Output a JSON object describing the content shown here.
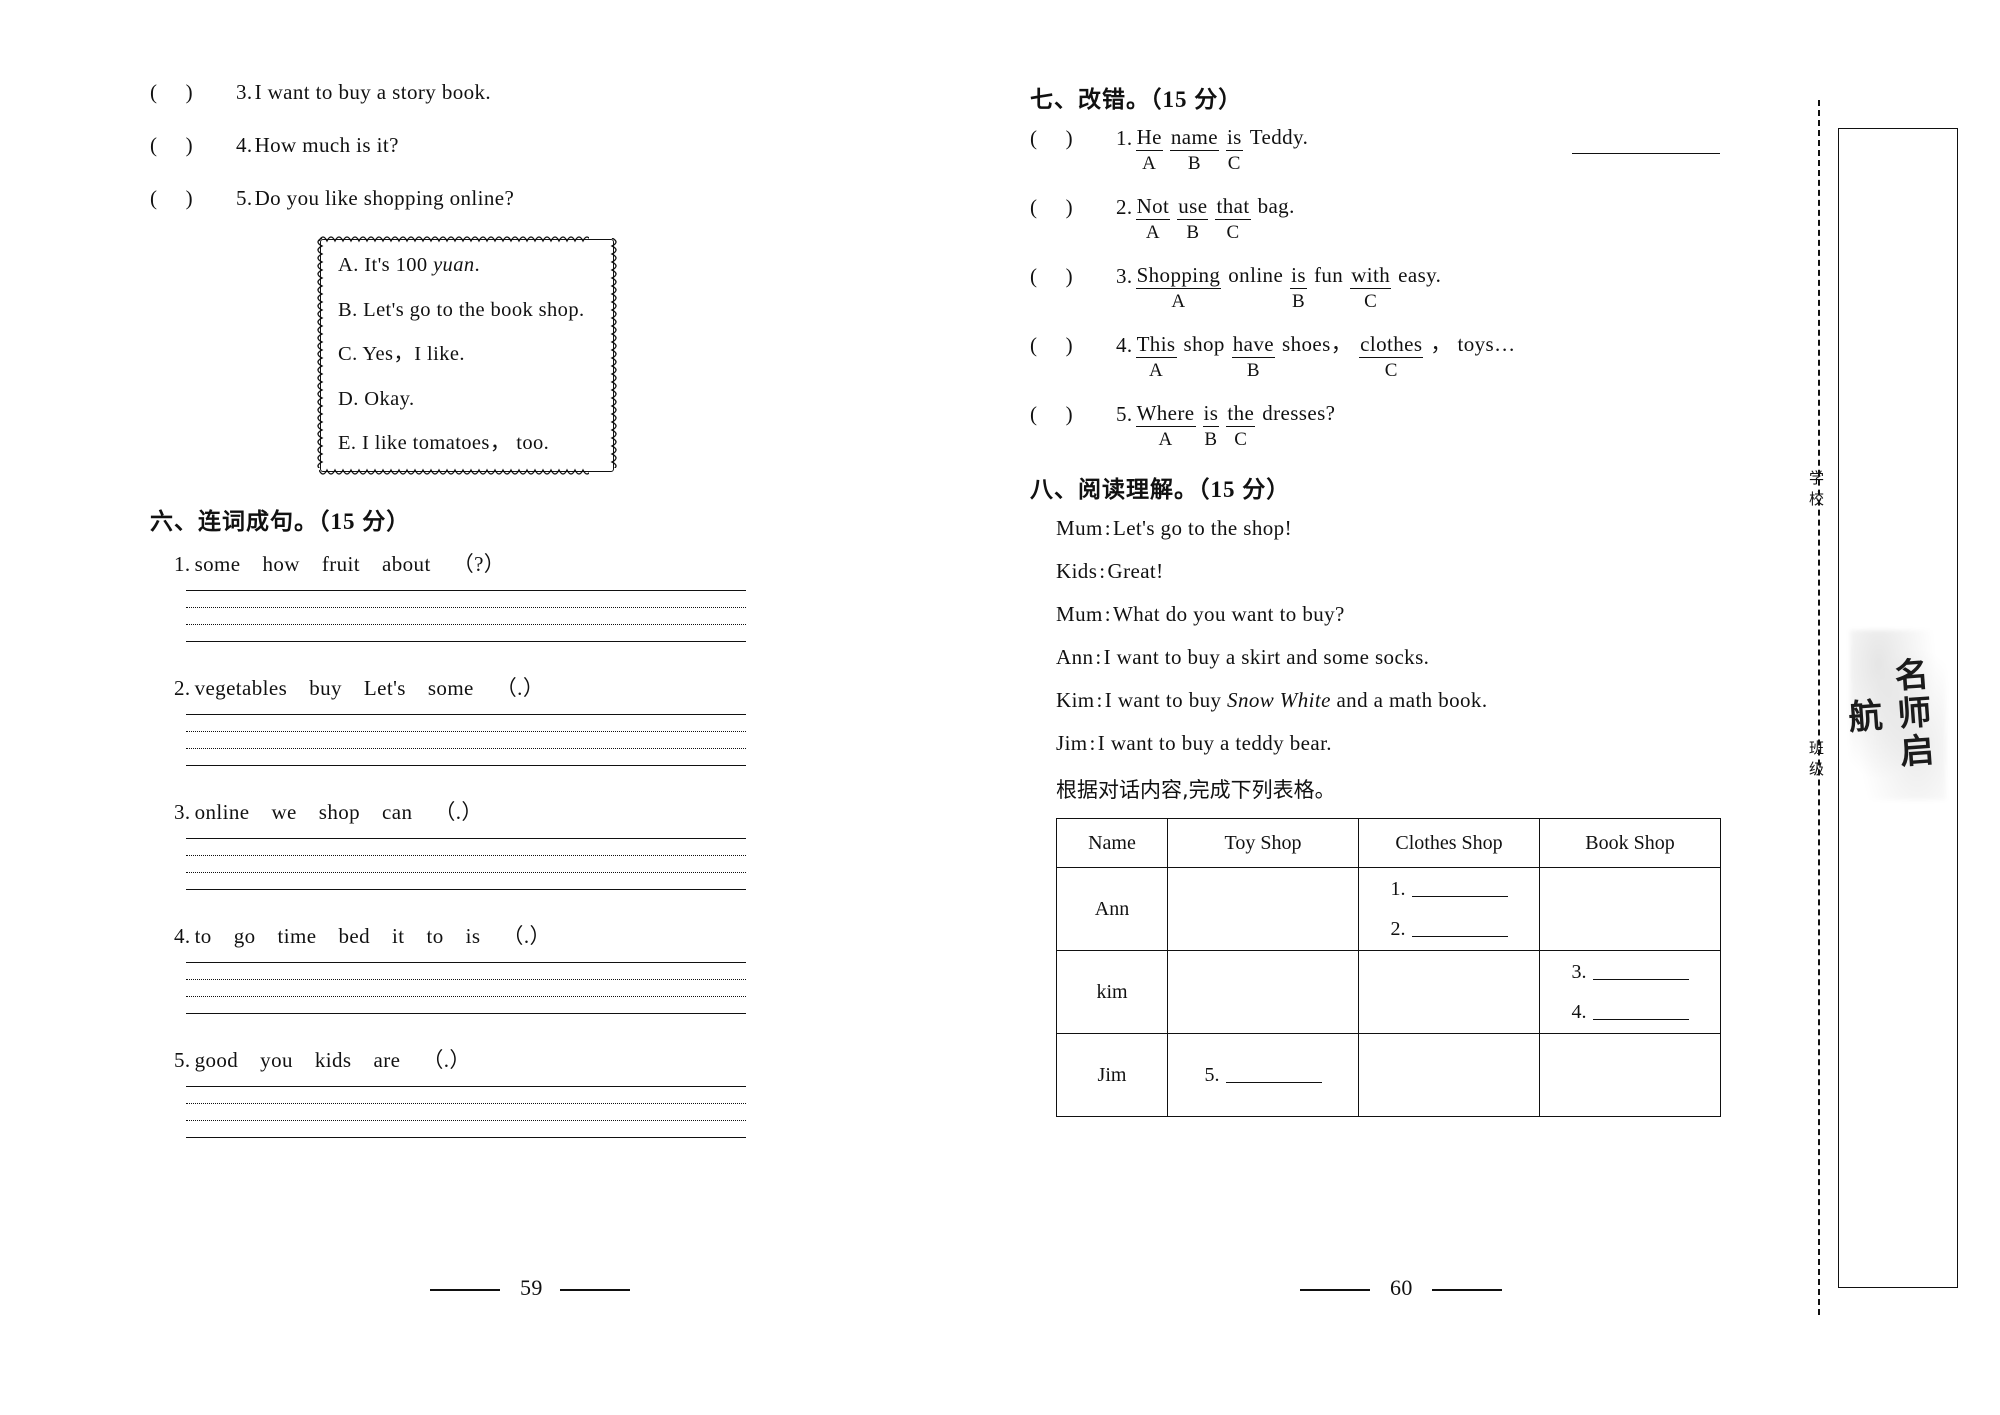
{
  "left_page": {
    "matching_items": [
      {
        "num": "3.",
        "text": "I want to buy a story book."
      },
      {
        "num": "4.",
        "text": "How much is it?"
      },
      {
        "num": "5.",
        "text": "Do you like shopping online?"
      }
    ],
    "options_box": {
      "options": [
        {
          "letter": "A.",
          "pre": "It's 100 ",
          "italic": "yuan",
          "post": "."
        },
        {
          "letter": "B.",
          "pre": "Let's go to the book shop.",
          "italic": "",
          "post": ""
        },
        {
          "letter": "C.",
          "pre": "Yes，I like.",
          "italic": "",
          "post": ""
        },
        {
          "letter": "D.",
          "pre": "Okay.",
          "italic": "",
          "post": ""
        },
        {
          "letter": "E.",
          "pre": "I like tomatoes， too.",
          "italic": "",
          "post": ""
        }
      ]
    },
    "section_six": {
      "heading": "六、连词成句。",
      "points": "（15 分）",
      "items": [
        {
          "num": "1.",
          "words": [
            "some",
            "how",
            "fruit",
            "about"
          ],
          "punct": "（?）"
        },
        {
          "num": "2.",
          "words": [
            "vegetables",
            "buy",
            "Let's",
            "some"
          ],
          "punct": "（.）"
        },
        {
          "num": "3.",
          "words": [
            "online",
            "we",
            "shop",
            "can"
          ],
          "punct": "（.）"
        },
        {
          "num": "4.",
          "words": [
            "to",
            "go",
            "time",
            "bed",
            "it",
            "to",
            "is"
          ],
          "punct": "（.）"
        },
        {
          "num": "5.",
          "words": [
            "good",
            "you",
            "kids",
            "are"
          ],
          "punct": "（.）"
        }
      ]
    },
    "page_number": "59"
  },
  "right_page": {
    "section_seven": {
      "heading": "七、改错。",
      "points": "（15 分）",
      "items": [
        {
          "num": "1.",
          "tokens": [
            {
              "t": "He",
              "lbl": "A",
              "u": true
            },
            {
              "t": "name",
              "lbl": "B",
              "u": true
            },
            {
              "t": "is",
              "lbl": "C",
              "u": true
            },
            {
              "t": "Teddy.",
              "lbl": "",
              "u": false
            }
          ]
        },
        {
          "num": "2.",
          "tokens": [
            {
              "t": "Not",
              "lbl": "A",
              "u": true
            },
            {
              "t": "use",
              "lbl": "B",
              "u": true
            },
            {
              "t": "that",
              "lbl": "C",
              "u": true
            },
            {
              "t": "bag.",
              "lbl": "",
              "u": false
            }
          ]
        },
        {
          "num": "3.",
          "tokens": [
            {
              "t": "Shopping",
              "lbl": "A",
              "u": true
            },
            {
              "t": "online",
              "lbl": "",
              "u": false
            },
            {
              "t": "is",
              "lbl": "B",
              "u": true
            },
            {
              "t": "fun",
              "lbl": "",
              "u": false
            },
            {
              "t": "with",
              "lbl": "C",
              "u": true
            },
            {
              "t": "easy.",
              "lbl": "",
              "u": false
            }
          ]
        },
        {
          "num": "4.",
          "tokens": [
            {
              "t": "This",
              "lbl": "A",
              "u": true
            },
            {
              "t": "shop",
              "lbl": "",
              "u": false
            },
            {
              "t": "have",
              "lbl": "B",
              "u": true
            },
            {
              "t": "shoes，",
              "lbl": "",
              "u": false
            },
            {
              "t": "clothes",
              "lbl": "C",
              "u": true
            },
            {
              "t": "， toys…",
              "lbl": "",
              "u": false
            }
          ]
        },
        {
          "num": "5.",
          "tokens": [
            {
              "t": "Where",
              "lbl": "A",
              "u": true
            },
            {
              "t": "is",
              "lbl": "B",
              "u": true
            },
            {
              "t": "the",
              "lbl": "C",
              "u": true
            },
            {
              "t": "dresses?",
              "lbl": "",
              "u": false
            }
          ]
        }
      ]
    },
    "section_eight": {
      "heading": "八、阅读理解。",
      "points": "（15 分）",
      "dialogue": [
        {
          "speaker": "Mum",
          "pre": "Let's go to the shop!",
          "italic": "",
          "post": ""
        },
        {
          "speaker": "Kids",
          "pre": "Great!",
          "italic": "",
          "post": ""
        },
        {
          "speaker": "Mum",
          "pre": "What do you want to buy?",
          "italic": "",
          "post": ""
        },
        {
          "speaker": "Ann",
          "pre": "I want to buy a skirt and some socks.",
          "italic": "",
          "post": ""
        },
        {
          "speaker": "Kim",
          "pre": "I want to buy ",
          "italic": "Snow White",
          "post": " and a math book."
        },
        {
          "speaker": "Jim",
          "pre": "I want to buy a teddy bear.",
          "italic": "",
          "post": ""
        }
      ],
      "instruction": "根据对话内容,完成下列表格。",
      "table": {
        "headers": [
          "Name",
          "Toy Shop",
          "Clothes Shop",
          "Book Shop"
        ],
        "rows": [
          {
            "name": "Ann",
            "toy": [],
            "clothes": [
              "1.",
              "2."
            ],
            "book": []
          },
          {
            "name": "kim",
            "toy": [],
            "clothes": [],
            "book": [
              "3.",
              "4."
            ]
          },
          {
            "name": "Jim",
            "toy": [
              "5."
            ],
            "clothes": [],
            "book": []
          }
        ]
      }
    },
    "page_number": "60"
  },
  "binding": {
    "label_top": "学校",
    "label_bottom": "班级",
    "seal_text": "名师启航"
  }
}
